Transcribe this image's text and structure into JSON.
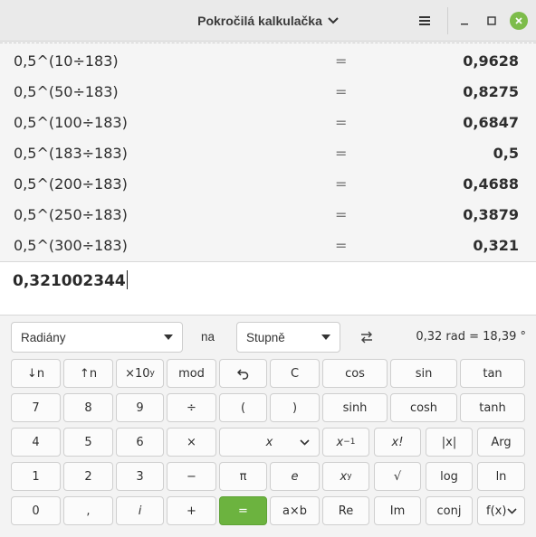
{
  "window": {
    "title": "Pokročilá kalkulačka"
  },
  "history": [
    {
      "expr": "0,5^(10÷183)",
      "eq": "=",
      "result": "0,9628"
    },
    {
      "expr": "0,5^(50÷183)",
      "eq": "=",
      "result": "0,8275"
    },
    {
      "expr": "0,5^(100÷183)",
      "eq": "=",
      "result": "0,6847"
    },
    {
      "expr": "0,5^(183÷183)",
      "eq": "=",
      "result": "0,5"
    },
    {
      "expr": "0,5^(200÷183)",
      "eq": "=",
      "result": "0,4688"
    },
    {
      "expr": "0,5^(250÷183)",
      "eq": "=",
      "result": "0,3879"
    },
    {
      "expr": "0,5^(300÷183)",
      "eq": "=",
      "result": "0,321"
    }
  ],
  "display": {
    "value": "0,321002344"
  },
  "conversion": {
    "from_unit": "Radiány",
    "connector": "na",
    "to_unit": "Stupně",
    "result": "0,32 rad  =  18,39 °"
  },
  "keypad": {
    "row1": [
      "↓n",
      "↑n",
      "×10",
      "mod",
      "↶",
      "C",
      "cos",
      "sin",
      "tan"
    ],
    "row1_sup": "y",
    "row2": [
      "7",
      "8",
      "9",
      "÷",
      "(",
      ")",
      "sinh",
      "cosh",
      "tanh"
    ],
    "row3": [
      "4",
      "5",
      "6",
      "×",
      "x",
      "x",
      "x!",
      "|x|",
      "Arg"
    ],
    "row3_sup": "−1",
    "row4": [
      "1",
      "2",
      "3",
      "−",
      "π",
      "e",
      "x",
      "√",
      "log",
      "ln"
    ],
    "row4_sup": "y",
    "row5": [
      "0",
      ",",
      "i",
      "+",
      "=",
      "a×b",
      "Re",
      "Im",
      "conj",
      "f(x)"
    ]
  },
  "colors": {
    "accent": "#6cb33f",
    "close_button": "#7dbc4a"
  }
}
